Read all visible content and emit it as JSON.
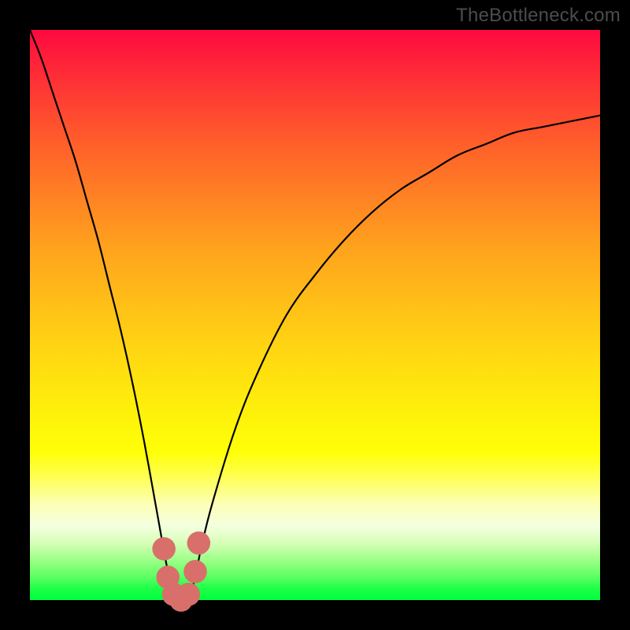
{
  "watermark": "TheBottleneck.com",
  "chart_data": {
    "type": "line",
    "title": "",
    "xlabel": "",
    "ylabel": "",
    "xlim": [
      0,
      100
    ],
    "ylim": [
      0,
      100
    ],
    "grid": false,
    "legend": false,
    "series": [
      {
        "name": "bottleneck-curve",
        "x": [
          0,
          2,
          4,
          6,
          8,
          10,
          12,
          14,
          16,
          18,
          20,
          22,
          24,
          25,
          26,
          27,
          28,
          29,
          30,
          32,
          36,
          40,
          45,
          50,
          55,
          60,
          65,
          70,
          75,
          80,
          85,
          90,
          95,
          100
        ],
        "y": [
          100,
          95,
          89,
          83,
          77,
          70,
          63,
          55,
          47,
          38,
          28,
          17,
          6,
          2,
          0,
          0,
          1,
          4,
          9,
          17,
          30,
          40,
          50,
          57,
          63,
          68,
          72,
          75,
          78,
          80,
          82,
          83,
          84,
          85
        ]
      }
    ],
    "markers": [
      {
        "name": "dot-left-upper",
        "x": 23.5,
        "y": 9,
        "r": 1.5
      },
      {
        "name": "dot-left-lower",
        "x": 24.2,
        "y": 4,
        "r": 1.5
      },
      {
        "name": "dot-mid-1",
        "x": 25.2,
        "y": 1,
        "r": 1.5
      },
      {
        "name": "dot-mid-2",
        "x": 26.5,
        "y": 0,
        "r": 1.5
      },
      {
        "name": "dot-mid-3",
        "x": 27.8,
        "y": 1,
        "r": 1.5
      },
      {
        "name": "dot-right-lower",
        "x": 29.0,
        "y": 5,
        "r": 1.5
      },
      {
        "name": "dot-right-upper",
        "x": 29.6,
        "y": 10,
        "r": 1.5
      }
    ],
    "colors": {
      "curve": "#000000",
      "markers": "#d96f6b",
      "gradient_top": "#fe093f",
      "gradient_mid": "#fef30a",
      "gradient_bottom": "#00ff3d",
      "frame": "#000000",
      "watermark": "#4c4c4c"
    }
  }
}
